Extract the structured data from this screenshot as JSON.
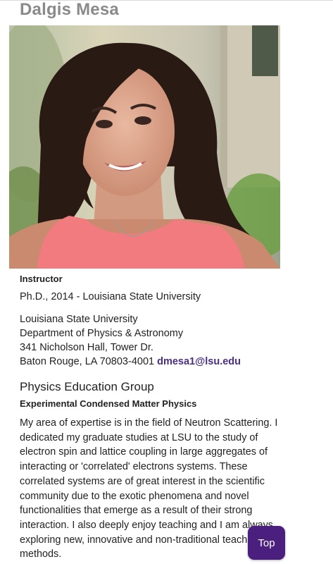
{
  "profile": {
    "name": "Dalgis Mesa",
    "photo_alt": "Dalgis Mesa",
    "title": "Instructor",
    "degree": "Ph.D., 2014 - Louisiana State University",
    "address": {
      "line1": "Louisiana State University",
      "line2": "Department of Physics & Astronomy",
      "line3": "341 Nicholson Hall, Tower Dr.",
      "line4": "Baton Rouge, LA 70803-4001"
    },
    "email": "dmesa1@lsu.edu",
    "group": "Physics Education Group",
    "research_area": "Experimental Condensed Matter Physics",
    "bio": "My area of expertise is in the field of Neutron Scattering. I dedicated my graduate studies at LSU to the study of electron spin and lattice coupling in large aggregates of interacting or 'correlated' electrons systems. These correlated systems are of great interest in the scientific community due to the exotic phenomena and novel functionalities that emerge as a result of their strong interaction. I also deeply enjoy teaching and I am always exploring new, innovative and non-traditional teaching methods."
  },
  "top_button": {
    "label": "Top"
  },
  "colors": {
    "accent": "#4b1f7d",
    "link": "#4b2e83",
    "heading_gray": "#8a8a8a"
  }
}
